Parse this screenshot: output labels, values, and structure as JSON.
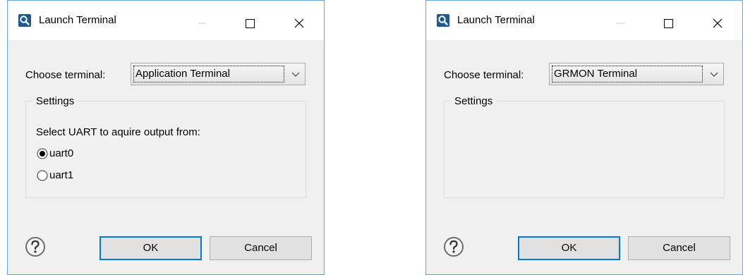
{
  "dialogs": [
    {
      "title": "Launch Terminal",
      "choose_label": "Choose terminal:",
      "terminal_value": "Application Terminal",
      "settings_label": "Settings",
      "uart_prompt": "Select UART to aquire output from:",
      "uart_options": [
        {
          "label": "uart0",
          "selected": true
        },
        {
          "label": "uart1",
          "selected": false
        }
      ],
      "ok_label": "OK",
      "cancel_label": "Cancel"
    },
    {
      "title": "Launch Terminal",
      "choose_label": "Choose terminal:",
      "terminal_value": "GRMON Terminal",
      "settings_label": "Settings",
      "ok_label": "OK",
      "cancel_label": "Cancel"
    }
  ],
  "icons": {
    "app": "search-magnifier-icon",
    "help": "question-mark-icon",
    "minimize": "minimize-icon",
    "maximize": "maximize-icon",
    "close": "close-icon",
    "dropdown": "chevron-down-icon"
  },
  "colors": {
    "dialog_bg": "#f0f0f0",
    "titlebar_bg": "#ffffff",
    "window_border": "#6aa5d9",
    "default_button_border": "#0078d7",
    "app_icon_bg": "#1e5a8e"
  }
}
